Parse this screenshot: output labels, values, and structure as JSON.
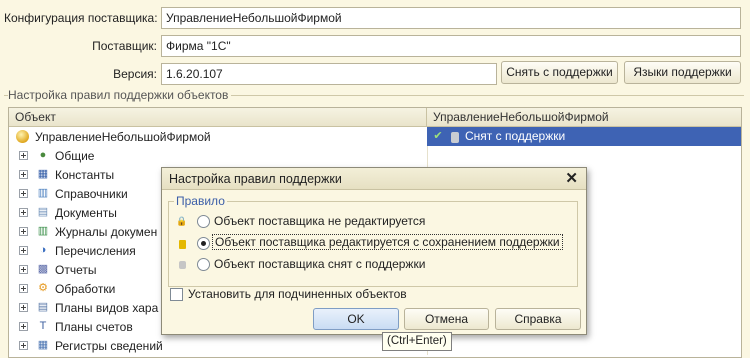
{
  "form": {
    "config_label": "Конфигурация поставщика:",
    "config_value": "УправлениеНебольшойФирмой",
    "supplier_label": "Поставщик:",
    "supplier_value": "Фирма \"1С\"",
    "version_label": "Версия:",
    "version_value": "1.6.20.107",
    "remove_support_btn": "Снять с поддержки",
    "support_languages_btn": "Языки поддержки"
  },
  "group": {
    "title": "Настройка правил поддержки объектов"
  },
  "tree": {
    "col_object": "Объект",
    "col_config": "УправлениеНебольшойФирмой",
    "root_label": "УправлениеНебольшойФирмой",
    "root_status": "Снят с поддержки",
    "items": [
      {
        "label": "Общие",
        "icon": "common-icon"
      },
      {
        "label": "Константы",
        "icon": "constants-icon"
      },
      {
        "label": "Справочники",
        "icon": "catalogs-icon"
      },
      {
        "label": "Документы",
        "icon": "documents-icon"
      },
      {
        "label": "Журналы докумен",
        "icon": "journals-icon"
      },
      {
        "label": "Перечисления",
        "icon": "enums-icon"
      },
      {
        "label": "Отчеты",
        "icon": "reports-icon"
      },
      {
        "label": "Обработки",
        "icon": "processing-icon"
      },
      {
        "label": "Планы видов хара",
        "icon": "char-plans-icon"
      },
      {
        "label": "Планы счетов",
        "icon": "accounts-icon"
      },
      {
        "label": "Регистры сведений",
        "icon": "registers-icon"
      }
    ]
  },
  "dialog": {
    "title": "Настройка правил поддержки",
    "group_title": "Правило",
    "options": [
      {
        "label": "Объект поставщика не редактируется",
        "selected": false
      },
      {
        "label": "Объект поставщика редактируется с сохранением поддержки",
        "selected": true
      },
      {
        "label": "Объект поставщика снят с поддержки",
        "selected": false
      }
    ],
    "apply_children_label": "Установить для подчиненных объектов",
    "ok_btn": "OK",
    "cancel_btn": "Отмена",
    "help_btn": "Справка",
    "tooltip": "(Ctrl+Enter)"
  },
  "colors": {
    "selection": "#3e63b4",
    "dialog_ok": "#d5e4f7"
  }
}
